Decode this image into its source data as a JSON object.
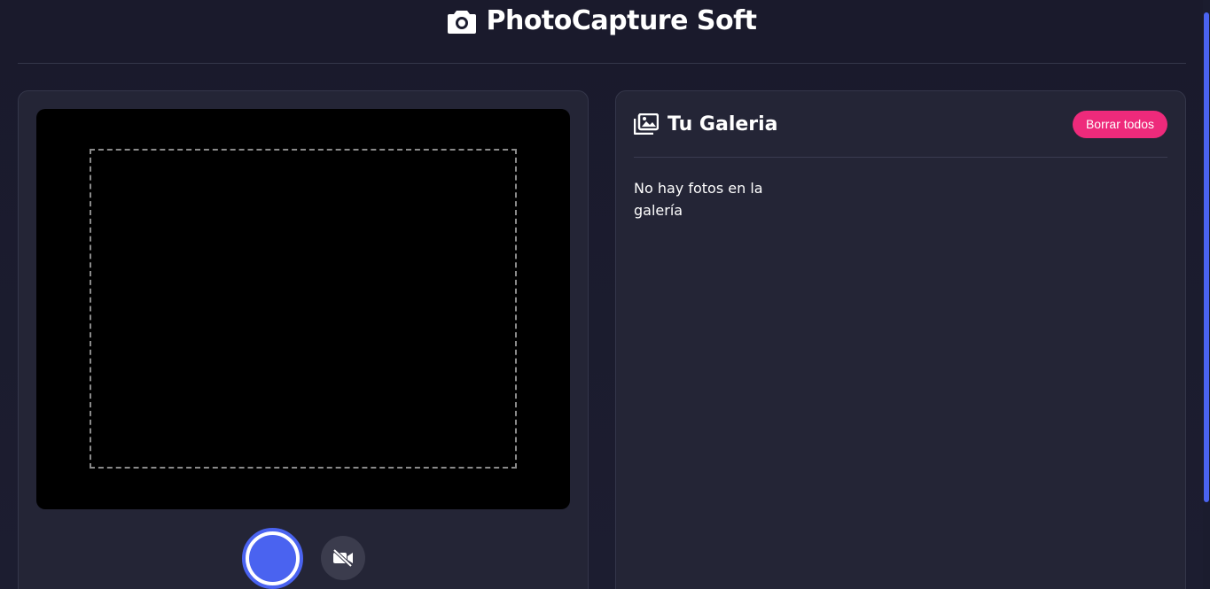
{
  "app": {
    "title": "PhotoCapture Soft",
    "title_icon": "camera-icon"
  },
  "camera": {
    "shutter_icon": "shutter-button",
    "toggle_icon": "video-off-icon"
  },
  "gallery": {
    "title": "Tu Galeria",
    "title_icon": "images-icon",
    "clear_label": "Borrar todos",
    "empty_message": "No hay fotos en la galería"
  },
  "colors": {
    "background": "#1b1c2e",
    "panel": "#242536",
    "accent_blue": "#4a63f0",
    "accent_pink": "#ee2a7b"
  }
}
